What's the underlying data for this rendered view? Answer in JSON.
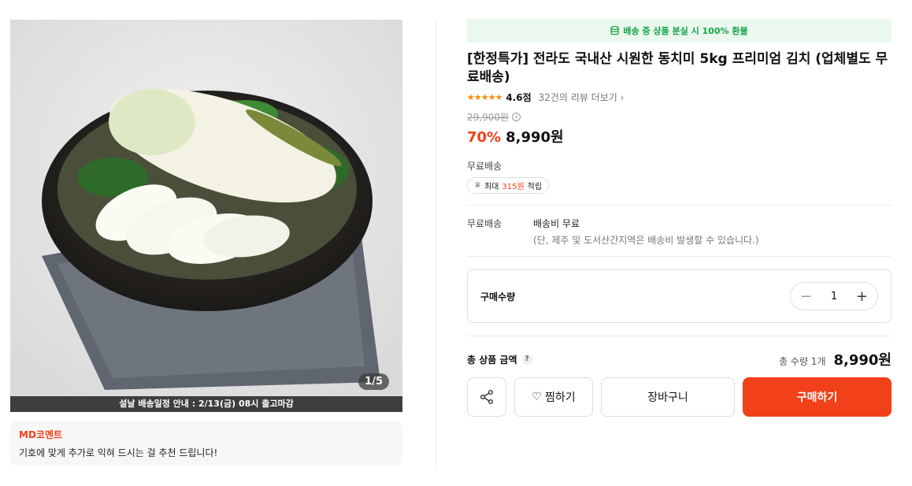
{
  "gallery": {
    "counter": "1/5",
    "banner": "설날 배송일정 안내 : 2/13(금) 08시 출고마감"
  },
  "md": {
    "title": "MD코멘트",
    "text": "기호에 맞게 추가로 익혀 드시는 걸 추천 드립니다!"
  },
  "refund_notice": "배송 중 상품 분실 시 100% 환불",
  "product": {
    "title": "[한정특가] 전라도 국내산 시원한 동치미 5kg 프리미엄 김치 (업체별도 무료배송)",
    "rating": "4.6점",
    "review_link": "32건의 리뷰 더보기",
    "original_price": "29,900원",
    "discount": "70%",
    "price": "8,990원"
  },
  "shipping": {
    "label": "무료배송",
    "points_prefix": "최대",
    "points_value": "315원",
    "points_suffix": "적립",
    "row_label": "무료배송",
    "row_value": "배송비 무료",
    "row_note": "(단, 제주 및 도서산간지역은 배송비 발생할 수 있습니다.)"
  },
  "quantity": {
    "label": "구매수량",
    "value": "1"
  },
  "total": {
    "label": "총 상품 금액",
    "qty_text": "총 수량 1개",
    "price": "8,990원"
  },
  "buttons": {
    "wish": "찜하기",
    "cart": "장바구니",
    "buy": "구매하기"
  },
  "colors": {
    "accent": "#f2401a",
    "refund_green": "#17a34a",
    "star": "#ff8a00"
  }
}
